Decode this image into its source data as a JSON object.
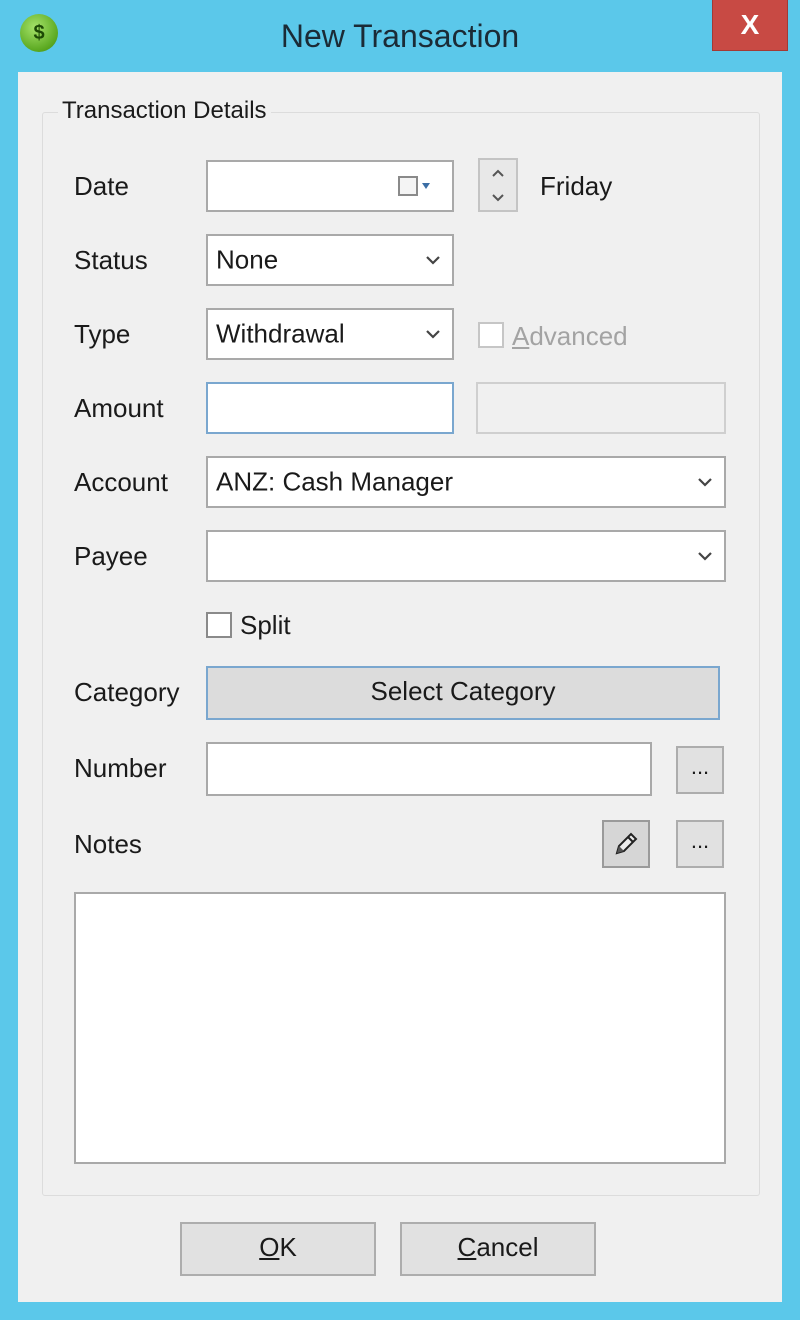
{
  "window": {
    "title": "New Transaction",
    "app_icon": "dollar-coin-icon",
    "app_icon_glyph": "$",
    "close_glyph": "X"
  },
  "group": {
    "title": "Transaction Details"
  },
  "date": {
    "label": "Date",
    "value": "",
    "weekday": "Friday"
  },
  "status": {
    "label": "Status",
    "value": "None"
  },
  "type": {
    "label": "Type",
    "value": "Withdrawal",
    "advanced_first": "A",
    "advanced_rest": "dvanced",
    "advanced_checked": false
  },
  "amount": {
    "label": "Amount",
    "value": "",
    "secondary_value": ""
  },
  "account": {
    "label": "Account",
    "value": "ANZ: Cash Manager"
  },
  "payee": {
    "label": "Payee",
    "value": ""
  },
  "split": {
    "label": "Split",
    "checked": false
  },
  "category": {
    "label": "Category",
    "button": "Select Category"
  },
  "number": {
    "label": "Number",
    "value": "",
    "browse": "..."
  },
  "notes": {
    "label": "Notes",
    "browse": "...",
    "value": ""
  },
  "buttons": {
    "ok_first": "O",
    "ok_rest": "K",
    "cancel_first": "C",
    "cancel_rest": "ancel"
  },
  "colors": {
    "titlebar": "#5bc8ea",
    "close": "#c84a44",
    "focus": "#7aa7cf"
  }
}
